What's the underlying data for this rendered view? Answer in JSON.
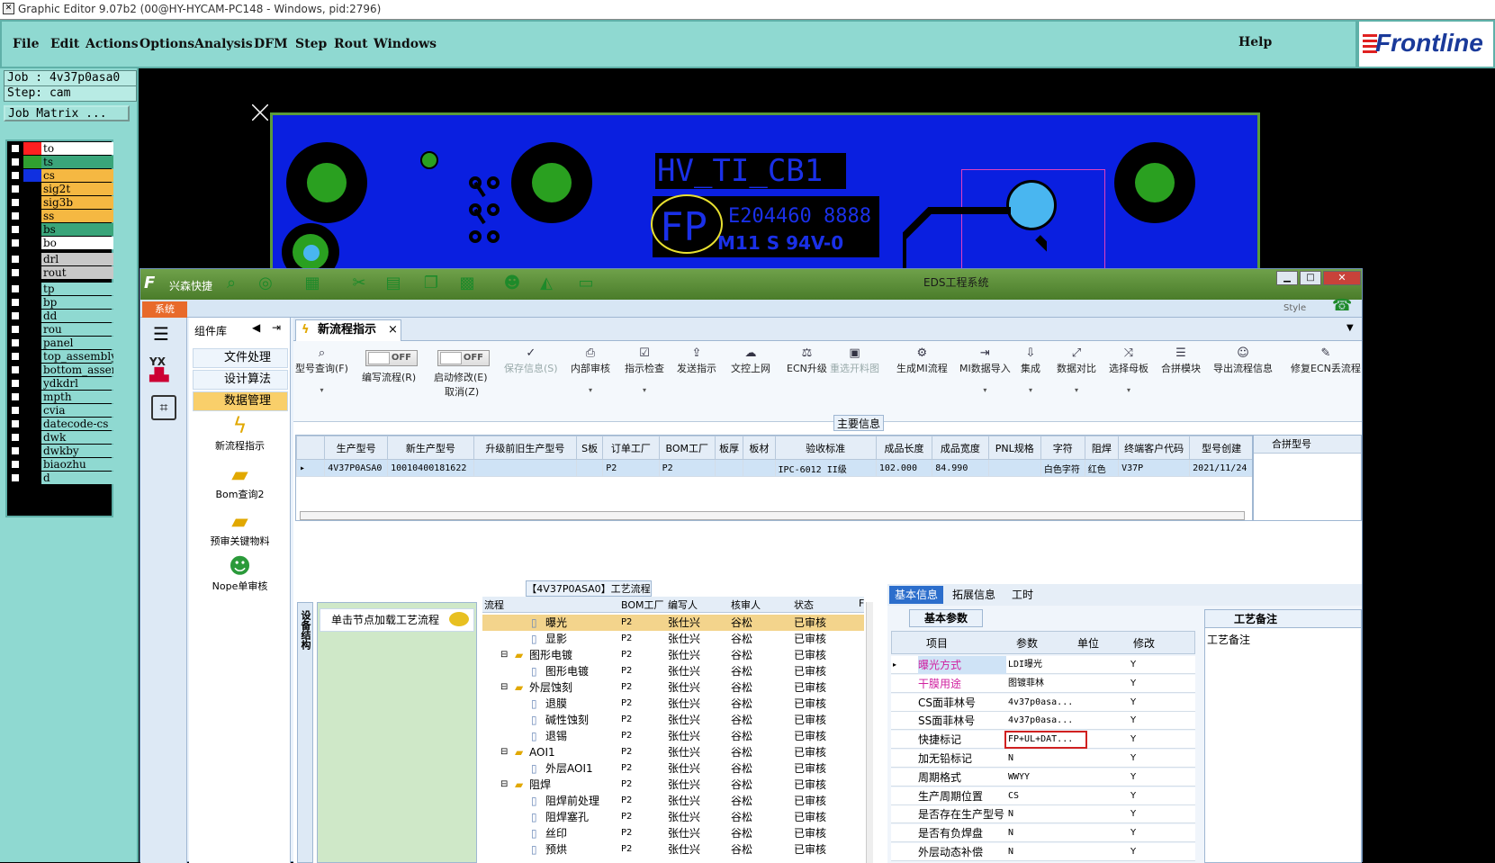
{
  "window": {
    "title": "Graphic Editor 9.07b2 (00@HY-HYCAM-PC148 - Windows, pid:2796)"
  },
  "menu": [
    "File",
    "Edit",
    "Actions",
    "Options",
    "Analysis",
    "DFM",
    "Step",
    "Rout",
    "Windows"
  ],
  "help": "Help",
  "logo": "Frontline",
  "job": {
    "job": "Job : 4v37p0asa0",
    "step": "Step: cam",
    "matrix": "Job Matrix ..."
  },
  "layers": [
    {
      "name": "to",
      "color": "#ff2020",
      "bg": "#ffffff"
    },
    {
      "name": "ts",
      "color": "#30a030",
      "bg": "#3aa57a"
    },
    {
      "name": "cs",
      "color": "#1030e0",
      "bg": "#f5b842"
    },
    {
      "name": "sig2t",
      "color": "#000000",
      "bg": "#f5b842"
    },
    {
      "name": "sig3b",
      "color": "#000000",
      "bg": "#f5b842"
    },
    {
      "name": "ss",
      "color": "#000000",
      "bg": "#f5b842"
    },
    {
      "name": "bs",
      "color": "#000000",
      "bg": "#3aa57a"
    },
    {
      "name": "bo",
      "color": "#000000",
      "bg": "#ffffff"
    },
    {
      "name": "drl",
      "color": "#000000",
      "bg": "#c8c8c8"
    },
    {
      "name": "rout",
      "color": "#000000",
      "bg": "#c8c8c8"
    },
    {
      "name": "tp",
      "color": "#000000",
      "bg": "#8fd9d1"
    },
    {
      "name": "bp",
      "color": "#000000",
      "bg": "#8fd9d1"
    },
    {
      "name": "dd",
      "color": "#000000",
      "bg": "#8fd9d1"
    },
    {
      "name": "rou",
      "color": "#000000",
      "bg": "#8fd9d1"
    },
    {
      "name": "panel",
      "color": "#000000",
      "bg": "#8fd9d1"
    },
    {
      "name": "top_assembly",
      "color": "#000000",
      "bg": "#8fd9d1"
    },
    {
      "name": "bottom_assem",
      "color": "#000000",
      "bg": "#8fd9d1"
    },
    {
      "name": "ydkdrl",
      "color": "#000000",
      "bg": "#8fd9d1"
    },
    {
      "name": "mpth",
      "color": "#000000",
      "bg": "#8fd9d1"
    },
    {
      "name": "cvia",
      "color": "#000000",
      "bg": "#8fd9d1"
    },
    {
      "name": "datecode-cs",
      "color": "#000000",
      "bg": "#8fd9d1"
    },
    {
      "name": "dwk",
      "color": "#000000",
      "bg": "#8fd9d1"
    },
    {
      "name": "dwkby",
      "color": "#000000",
      "bg": "#8fd9d1"
    },
    {
      "name": "biaozhu",
      "color": "#000000",
      "bg": "#8fd9d1"
    },
    {
      "name": "d",
      "color": "#000000",
      "bg": "#8fd9d1"
    }
  ],
  "board": {
    "label1": "HV_TI_CB1",
    "label2": "FP",
    "label3": "E204460 8888",
    "label4": "M11 S 94V-0"
  },
  "eds": {
    "title": "EDS工程系统",
    "brand": "兴森快捷",
    "system": "系统",
    "style": "Style",
    "comp_title": "组件库",
    "comp_items": [
      "文件处理",
      "设计算法",
      "数据管理"
    ],
    "comp_big": [
      "新流程指示",
      "Bom查询2",
      "预审关键物料",
      "Nope单审核"
    ],
    "tab": "新流程指示",
    "toggle_off": "OFF",
    "ribbon": [
      {
        "label": "型号查询(F)",
        "icon": "⌕"
      },
      {
        "label": "编写流程(R)",
        "icon": ""
      },
      {
        "label": "启动修改(E)",
        "icon": ""
      },
      {
        "label": "保存信息(S)",
        "icon": "✓"
      },
      {
        "label": "内部审核",
        "icon": "⎙"
      },
      {
        "label": "指示检查",
        "icon": "☑"
      },
      {
        "label": "发送指示",
        "icon": "⇪"
      },
      {
        "label": "文控上网",
        "icon": "☁"
      },
      {
        "label": "ECN升级",
        "icon": "⚖"
      },
      {
        "label": "重选开料图",
        "icon": "▣"
      },
      {
        "label": "生成MI流程",
        "icon": "⚙"
      },
      {
        "label": "MI数据导入",
        "icon": "⇥"
      },
      {
        "label": "集成",
        "icon": "⇩"
      },
      {
        "label": "数据对比",
        "icon": "⤢"
      },
      {
        "label": "选择母板",
        "icon": "⤨"
      },
      {
        "label": "合拼模块",
        "icon": "☰"
      },
      {
        "label": "导出流程信息",
        "icon": "☺"
      },
      {
        "label": "修复ECN丢流程",
        "icon": "✎"
      }
    ],
    "cancel": "取消(Z)",
    "main_info": "主要信息",
    "grid_headers": [
      "生产型号",
      "新生产型号",
      "升级前旧生产型号",
      "S板",
      "订单工厂",
      "BOM工厂",
      "板厚",
      "板材",
      "验收标准",
      "成品长度",
      "成品宽度",
      "PNL规格",
      "字符",
      "阻焊",
      "终端客户代码",
      "型号创建"
    ],
    "grid_row": [
      "4V37P0ASA0",
      "10010400181622",
      "",
      "",
      "P2",
      "P2",
      "",
      "",
      "IPC-6012 II级",
      "102.000",
      "84.990",
      "",
      "白色字符",
      "红色",
      "V37P",
      "2021/11/24"
    ],
    "merge_header": "合拼型号",
    "flow_title": "【4V37P0ASA0】工艺流程",
    "flow_side": "设备结构",
    "flow_hint": "单击节点加载工艺流程",
    "flow_headers": [
      "流程",
      "BOM工厂",
      "编写人",
      "核审人",
      "状态",
      "F"
    ],
    "flow_rows": [
      {
        "name": "曝光",
        "lvl": 2,
        "f": "P2",
        "w": "张仕兴",
        "r": "谷松",
        "s": "已审核"
      },
      {
        "name": "显影",
        "lvl": 2,
        "f": "P2",
        "w": "张仕兴",
        "r": "谷松",
        "s": "已审核"
      },
      {
        "name": "图形电镀",
        "lvl": 1,
        "f": "P2",
        "w": "张仕兴",
        "r": "谷松",
        "s": "已审核"
      },
      {
        "name": "图形电镀",
        "lvl": 2,
        "f": "P2",
        "w": "张仕兴",
        "r": "谷松",
        "s": "已审核"
      },
      {
        "name": "外层蚀刻",
        "lvl": 1,
        "f": "P2",
        "w": "张仕兴",
        "r": "谷松",
        "s": "已审核"
      },
      {
        "name": "退膜",
        "lvl": 2,
        "f": "P2",
        "w": "张仕兴",
        "r": "谷松",
        "s": "已审核"
      },
      {
        "name": "碱性蚀刻",
        "lvl": 2,
        "f": "P2",
        "w": "张仕兴",
        "r": "谷松",
        "s": "已审核"
      },
      {
        "name": "退锡",
        "lvl": 2,
        "f": "P2",
        "w": "张仕兴",
        "r": "谷松",
        "s": "已审核"
      },
      {
        "name": "AOI1",
        "lvl": 1,
        "f": "P2",
        "w": "张仕兴",
        "r": "谷松",
        "s": "已审核"
      },
      {
        "name": "外层AOI1",
        "lvl": 2,
        "f": "P2",
        "w": "张仕兴",
        "r": "谷松",
        "s": "已审核"
      },
      {
        "name": "阻焊",
        "lvl": 1,
        "f": "P2",
        "w": "张仕兴",
        "r": "谷松",
        "s": "已审核"
      },
      {
        "name": "阻焊前处理",
        "lvl": 2,
        "f": "P2",
        "w": "张仕兴",
        "r": "谷松",
        "s": "已审核"
      },
      {
        "name": "阻焊塞孔",
        "lvl": 2,
        "f": "P2",
        "w": "张仕兴",
        "r": "谷松",
        "s": "已审核"
      },
      {
        "name": "丝印",
        "lvl": 2,
        "f": "P2",
        "w": "张仕兴",
        "r": "谷松",
        "s": "已审核"
      },
      {
        "name": "预烘",
        "lvl": 2,
        "f": "P2",
        "w": "张仕兴",
        "r": "谷松",
        "s": "已审核"
      }
    ],
    "prop_tabs": [
      "基本信息",
      "拓展信息",
      "工时"
    ],
    "prop_section": "基本参数",
    "prop_headers": [
      "项目",
      "参数",
      "单位",
      "修改"
    ],
    "prop_rows": [
      {
        "item": "曝光方式",
        "param": "LDI曝光",
        "edit": "Y",
        "hl": true
      },
      {
        "item": "干膜用途",
        "param": "图镀菲林",
        "edit": "Y",
        "hl": true
      },
      {
        "item": "CS面菲林号",
        "param": "4v37p0asa...",
        "edit": "Y",
        "hl": false
      },
      {
        "item": "SS面菲林号",
        "param": "4v37p0asa...",
        "edit": "Y",
        "hl": false
      },
      {
        "item": "快捷标记",
        "param": "FP+UL+DAT...",
        "edit": "Y",
        "hl": false
      },
      {
        "item": "加无铅标记",
        "param": "N",
        "edit": "Y",
        "hl": false
      },
      {
        "item": "周期格式",
        "param": "WWYY",
        "edit": "Y",
        "hl": false
      },
      {
        "item": "生产周期位置",
        "param": "CS",
        "edit": "Y",
        "hl": false
      },
      {
        "item": "是否存在生产型号",
        "param": "N",
        "edit": "Y",
        "hl": false
      },
      {
        "item": "是否有负焊盘",
        "param": "N",
        "edit": "Y",
        "hl": false
      },
      {
        "item": "外层动态补偿",
        "param": "N",
        "edit": "Y",
        "hl": false
      }
    ],
    "remark_title": "工艺备注",
    "remark_label": "工艺备注"
  }
}
